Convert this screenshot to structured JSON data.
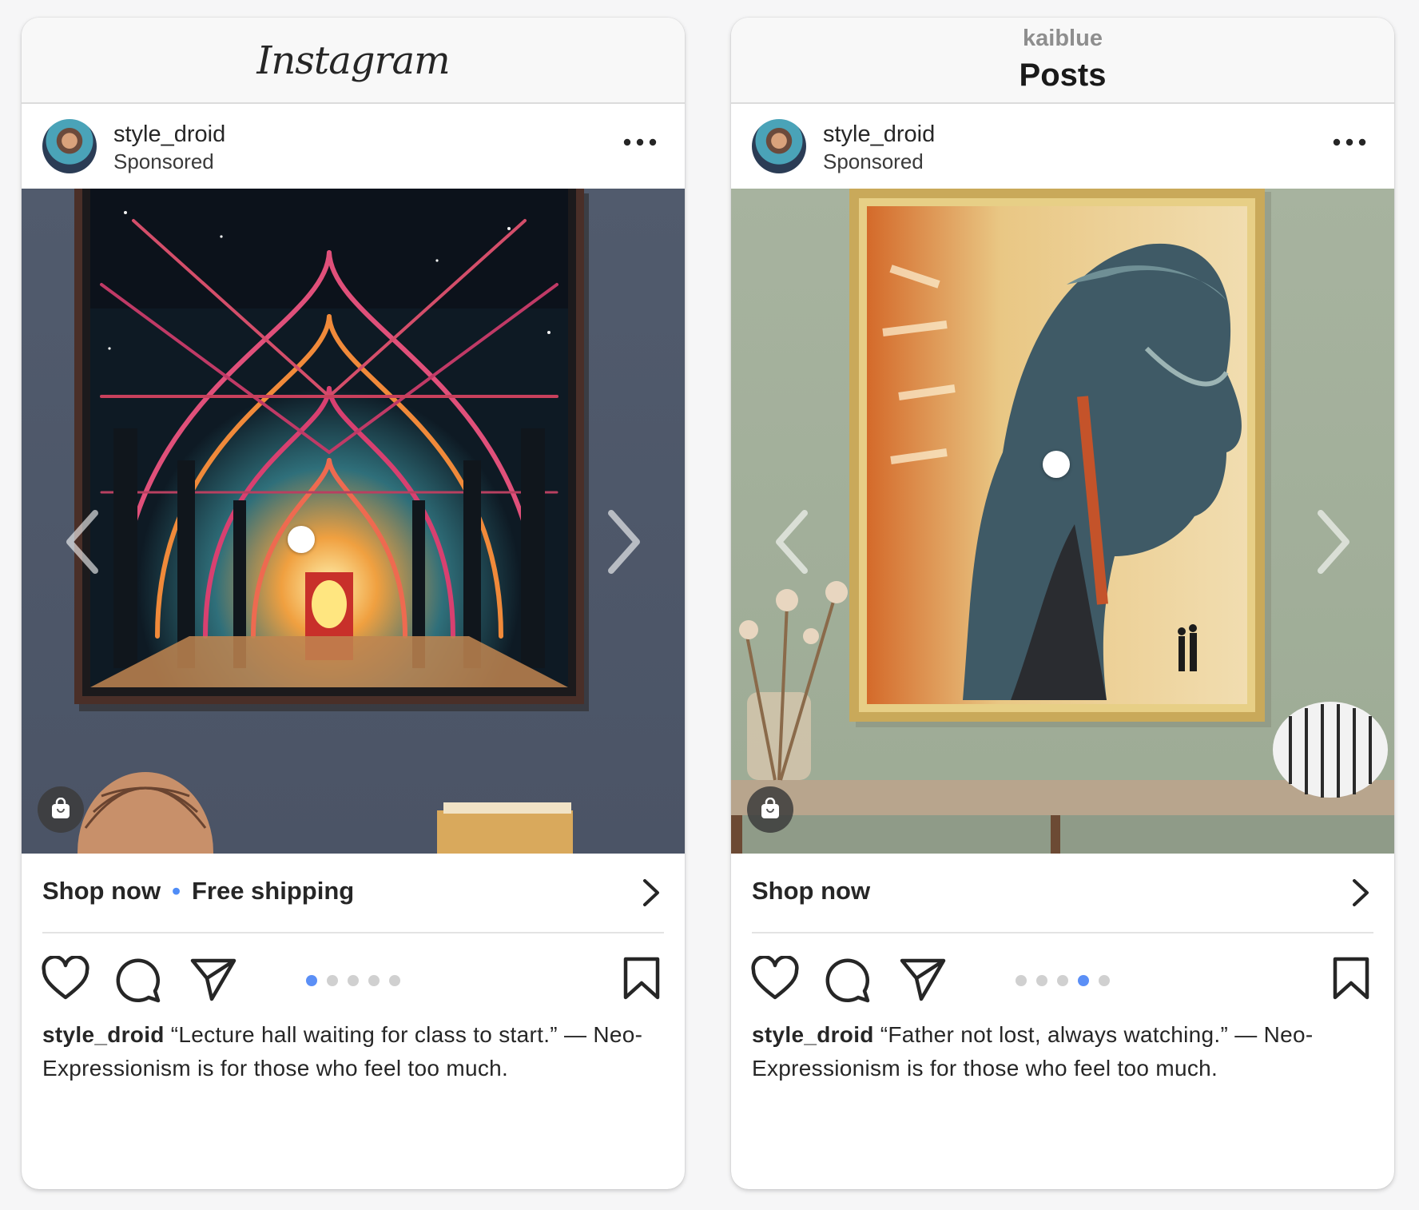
{
  "colors": {
    "accent_blue": "#5b8ff6",
    "text": "#262626",
    "muted": "#8e8e8e"
  },
  "posts": [
    {
      "header": {
        "logo": "Instagram"
      },
      "account": {
        "username": "style_droid",
        "label": "Sponsored"
      },
      "artwork": "lecture-hall-painting",
      "cta": {
        "primary": "Shop now",
        "secondary": "Free shipping"
      },
      "caption": {
        "username": "style_droid",
        "text": "“Lecture hall waiting for class to start.” — Neo-Expressionism is for those who feel too much."
      },
      "carousel": {
        "count": 5,
        "active": 0
      }
    },
    {
      "header": {
        "subtitle": "kaiblue",
        "title": "Posts"
      },
      "account": {
        "username": "style_droid",
        "label": "Sponsored"
      },
      "artwork": "father-profile-painting",
      "cta": {
        "primary": "Shop now"
      },
      "caption": {
        "username": "style_droid",
        "text": "“Father not lost, always watching.” — Neo-Expressionism is for those who feel too much."
      },
      "carousel": {
        "count": 5,
        "active": 3
      }
    }
  ],
  "icons": [
    "more-icon",
    "chevron-left-icon",
    "chevron-right-icon",
    "shopping-bag-icon",
    "heart-icon",
    "comment-icon",
    "share-icon",
    "bookmark-icon",
    "chevron-right-icon"
  ]
}
